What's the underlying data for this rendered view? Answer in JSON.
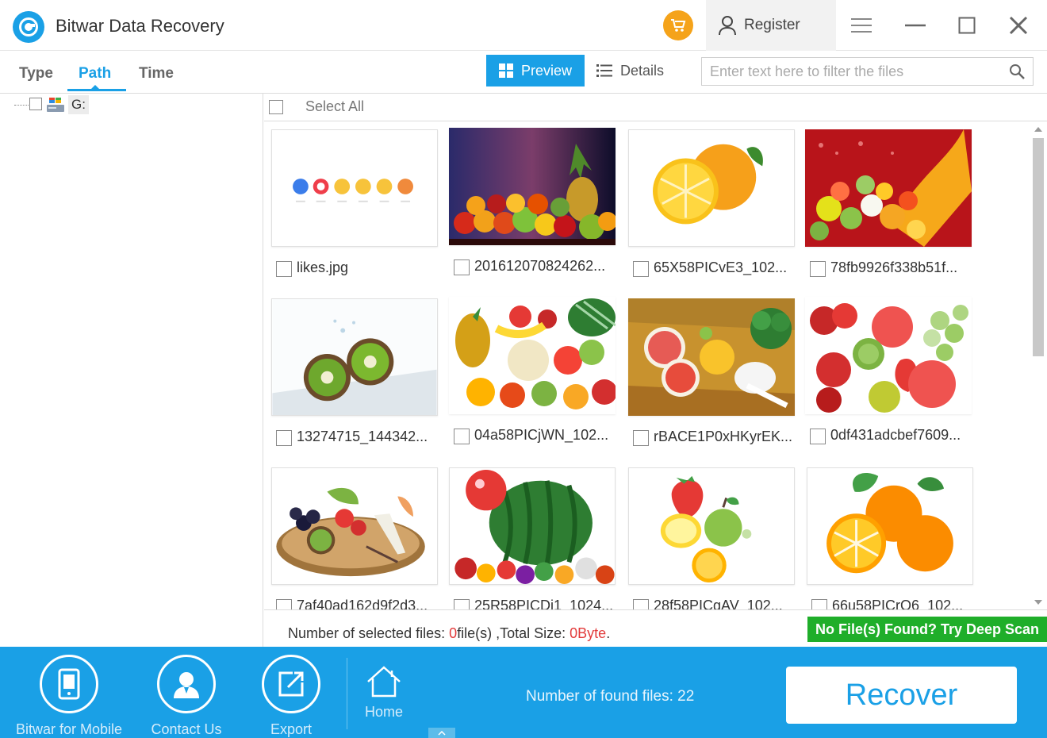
{
  "app": {
    "title": "Bitwar Data Recovery",
    "register_label": "Register",
    "cart_icon": "cart-icon",
    "brand_color": "#1aa0e6"
  },
  "left_tabs": [
    {
      "label": "Type",
      "active": false
    },
    {
      "label": "Path",
      "active": true
    },
    {
      "label": "Time",
      "active": false
    }
  ],
  "view": {
    "preview_label": "Preview",
    "details_label": "Details",
    "filter_placeholder": "Enter text here to filter the files"
  },
  "tree": {
    "drive_label": "G:"
  },
  "select_all_label": "Select All",
  "files": [
    {
      "name": "likes.jpg",
      "thumb": "likes"
    },
    {
      "name": "201612070824262...",
      "thumb": "fruit-pile-dark"
    },
    {
      "name": "65X58PICvE3_102...",
      "thumb": "oranges"
    },
    {
      "name": "78fb9926f338b51f...",
      "thumb": "fruit-juice-splash"
    },
    {
      "name": "13274715_144342...",
      "thumb": "kiwi-splash"
    },
    {
      "name": "04a58PICjWN_102...",
      "thumb": "fruit-collage"
    },
    {
      "name": "rBACE1P0xHKyrEK...",
      "thumb": "grapefruit-board"
    },
    {
      "name": "0df431adcbef7609...",
      "thumb": "mixed-fruit"
    },
    {
      "name": "7af40ad162d9f2d3...",
      "thumb": "fruit-plate"
    },
    {
      "name": "25R58PICDi1_1024...",
      "thumb": "watermelon"
    },
    {
      "name": "28f58PICgAV_102...",
      "thumb": "fruit-scatter"
    },
    {
      "name": "66u58PICrQ6_102...",
      "thumb": "orange-halves"
    }
  ],
  "status": {
    "selected_prefix": "Number of selected files: ",
    "selected_count": "0",
    "selected_unit": "file(s)",
    "size_prefix": " ,Total Size: ",
    "size_value": "0Byte",
    "size_suffix": ".",
    "deep_scan_label": "No File(s) Found? Try Deep Scan"
  },
  "footer": {
    "mobile_label": "Bitwar for Mobile",
    "contact_label": "Contact Us",
    "export_label": "Export",
    "home_label": "Home",
    "found_text": "Number of found files: 22",
    "recover_label": "Recover"
  }
}
